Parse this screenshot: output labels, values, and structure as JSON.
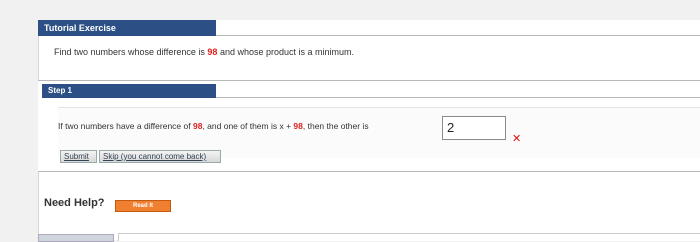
{
  "tutorial": {
    "header": "Tutorial Exercise",
    "problem_prefix": "Find two numbers whose difference is ",
    "problem_number": "98",
    "problem_suffix": " and whose product is a minimum."
  },
  "step": {
    "header": "Step 1",
    "q_prefix": "If two numbers have a difference of ",
    "q_diff": "98",
    "q_mid": ", and one of them is x + ",
    "q_x": "98",
    "q_suffix": ", then the other is",
    "answer_value": "2",
    "result_icon": "wrong-x-icon",
    "result_glyph": "✕"
  },
  "buttons": {
    "submit": "Submit",
    "skip": "Skip (you cannot come back)"
  },
  "help": {
    "label": "Need Help?",
    "read_it": "Read It"
  },
  "colors": {
    "header_bg": "#2c4f86",
    "highlight_number": "#d22222",
    "wrong_mark": "#d11111",
    "read_it_bg": "#f08030"
  }
}
